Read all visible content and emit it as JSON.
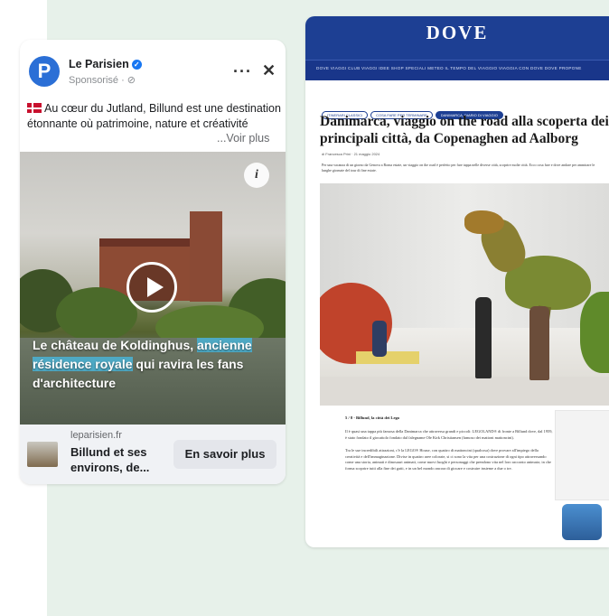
{
  "facebook_ad": {
    "page_name": "Le Parisien",
    "sponsored": "Sponsorisé · ⊘",
    "avatar_letter": "P",
    "body_text": "Au cœur du Jutland, Billund est une destination étonnante où patrimoine, nature et créativité",
    "see_more": "...Voir plus",
    "caption_before": "Le château de Koldinghus, ",
    "caption_highlight": "ancienne résidence royale",
    "caption_after": " qui ravira les fans d'architecture",
    "info_icon_glyph": "i",
    "link_domain": "leparisien.fr",
    "link_title": "Billund et ses environs, de...",
    "cta_label": "En savoir plus",
    "more_glyph": "···",
    "close_glyph": "✕"
  },
  "dove_article": {
    "logo": "DOVE",
    "nav_text": "DOVE VIAGGI   CLUB VIAGGI   IDEE   SHOP   SPECIALI   METEO   IL TEMPO DEL VIAGGIO   VIAGGIA CON DOVE   DOVE PROPONE",
    "tags": [
      "ITINERARI CLASSICI",
      "COSA FARE PER TERMINARE",
      "DANIMARCA, DIARIO DI VIAGGIO"
    ],
    "title": "Danimarca, viaggio on the road alla scoperta dei principali città, da Copenaghen ad Aalborg",
    "meta": "di Francesca Prini · 21 maggio 2024",
    "intro": "Per una vacanza di un giorno da Genova a Roma estate, un viaggio on the road è perfetto per fare tappa nelle diverse città, scoprire molte città. Ecco cosa fare e dove andare per ammirare le lunghe giornate del tour di fine estate.",
    "section_heading": "5 / 8 - Billund, la città dei Lego",
    "paragraph_1": "Il è quasi una tappa più famosa della Danimarca che attraversa grandi e piccoli: LEGOLAND® di fronte a Billund dove, dal 1959, è stato fondato il giocattolo fondato dal falegname Ole Kirk Christiansen (famoso dei mattoni mattoncini).",
    "paragraph_2": "Tra le sue incredibili attrazioni, c'è la LEGO® House, con quattro di mattoncini (qualcosa) dove provare all'impiego della creatività e dell'immaginazione. Divise in quattro aree colorate, si ci sono la vita per una costruzione di ogni tipo attraversando come una storia, animati e dinosauri animati, come nuovi luoghi e personaggi che prendono vita nel loro racconto animato; in che forma scoprire tutti alla fine dei gatti, e in un bel mondo ancora di giocare e costruire insieme a due o tre."
  }
}
